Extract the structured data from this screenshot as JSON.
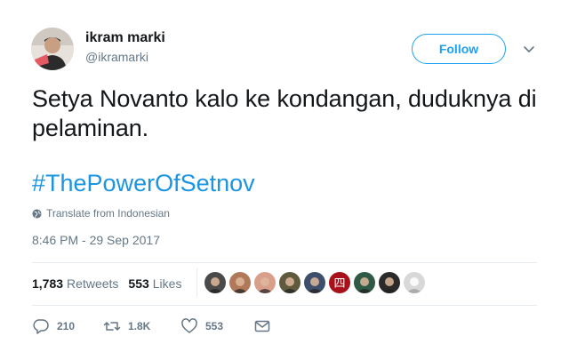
{
  "user": {
    "display_name": "ikram marki",
    "handle": "@ikramarki",
    "avatar_icon": "user-avatar"
  },
  "follow": {
    "label": "Follow",
    "color": "#1da1f2"
  },
  "tweet": {
    "text": "Setya Novanto kalo ke kondangan, duduknya di pelaminan.",
    "hashtag": "#ThePowerOfSetnov",
    "hashtag_color": "#1b95e0"
  },
  "translate": {
    "label": "Translate from Indonesian",
    "icon": "globe-icon"
  },
  "timestamp": "8:46 PM - 29 Sep 2017",
  "stats": {
    "retweets_count": "1,783",
    "retweets_label": "Retweets",
    "likes_count": "553",
    "likes_label": "Likes"
  },
  "likers": [
    {
      "icon": "liker-avatar",
      "color": "#4a4a4a"
    },
    {
      "icon": "liker-avatar",
      "color": "#b07a5a"
    },
    {
      "icon": "liker-avatar",
      "color": "#d8a08a"
    },
    {
      "icon": "liker-avatar",
      "color": "#5f5a3d"
    },
    {
      "icon": "liker-avatar",
      "color": "#3d4f6b"
    },
    {
      "icon": "liker-avatar",
      "color": "#a8111a",
      "glyph": "四"
    },
    {
      "icon": "liker-avatar",
      "color": "#2f5a45"
    },
    {
      "icon": "liker-avatar",
      "color": "#2a2a2a"
    },
    {
      "icon": "liker-avatar",
      "color": "#d8d8d8"
    }
  ],
  "actions": {
    "reply_count": "210",
    "retweet_count": "1.8K",
    "like_count": "553",
    "reply_icon": "reply-icon",
    "retweet_icon": "retweet-icon",
    "like_icon": "heart-icon",
    "message_icon": "envelope-icon"
  }
}
